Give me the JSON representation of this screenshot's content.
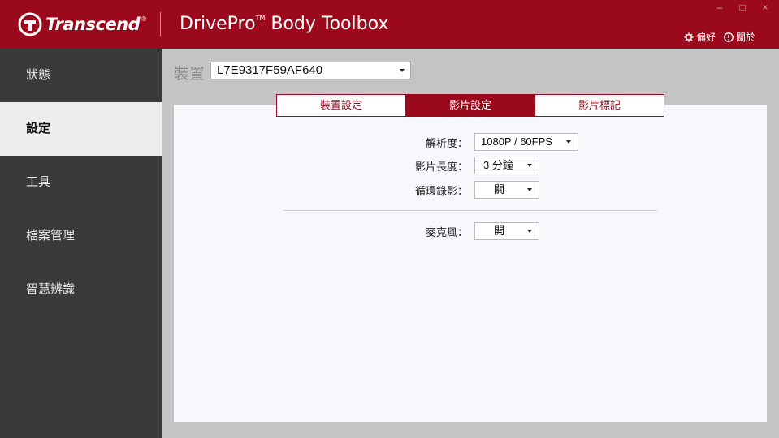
{
  "header": {
    "brand": "Transcend",
    "brand_mark": "®",
    "title_main": "DrivePro",
    "title_tm": "TM",
    "title_rest": " Body Toolbox",
    "window_controls": {
      "minimize": "–",
      "maximize": "□",
      "close": "×"
    },
    "links": {
      "preferences": "偏好",
      "about": "關於"
    }
  },
  "sidebar": {
    "items": [
      {
        "label": "狀態"
      },
      {
        "label": "設定"
      },
      {
        "label": "工具"
      },
      {
        "label": "檔案管理"
      },
      {
        "label": "智慧辨識"
      }
    ],
    "active_index": 1
  },
  "device": {
    "label": "裝置",
    "selected": "L7E9317F59AF640"
  },
  "tabs": [
    {
      "label": "裝置設定"
    },
    {
      "label": "影片設定"
    },
    {
      "label": "影片標記"
    }
  ],
  "form": {
    "resolution": {
      "label": "解析度：",
      "value": "1080P / 60FPS"
    },
    "clip_length": {
      "label": "影片長度：",
      "value": "3 分鐘"
    },
    "loop_recording": {
      "label": "循環錄影：",
      "value": "關"
    },
    "microphone": {
      "label": "麥克風：",
      "value": "開"
    }
  },
  "colors": {
    "brand_red": "#9a0a1c",
    "sidebar_bg": "#3a3a3a",
    "content_bg": "#c4c4c4",
    "panel_bg": "#f8f7fc"
  },
  "icons": [
    "transcend-logo-icon",
    "gear-icon",
    "info-icon",
    "chevron-down-icon"
  ]
}
